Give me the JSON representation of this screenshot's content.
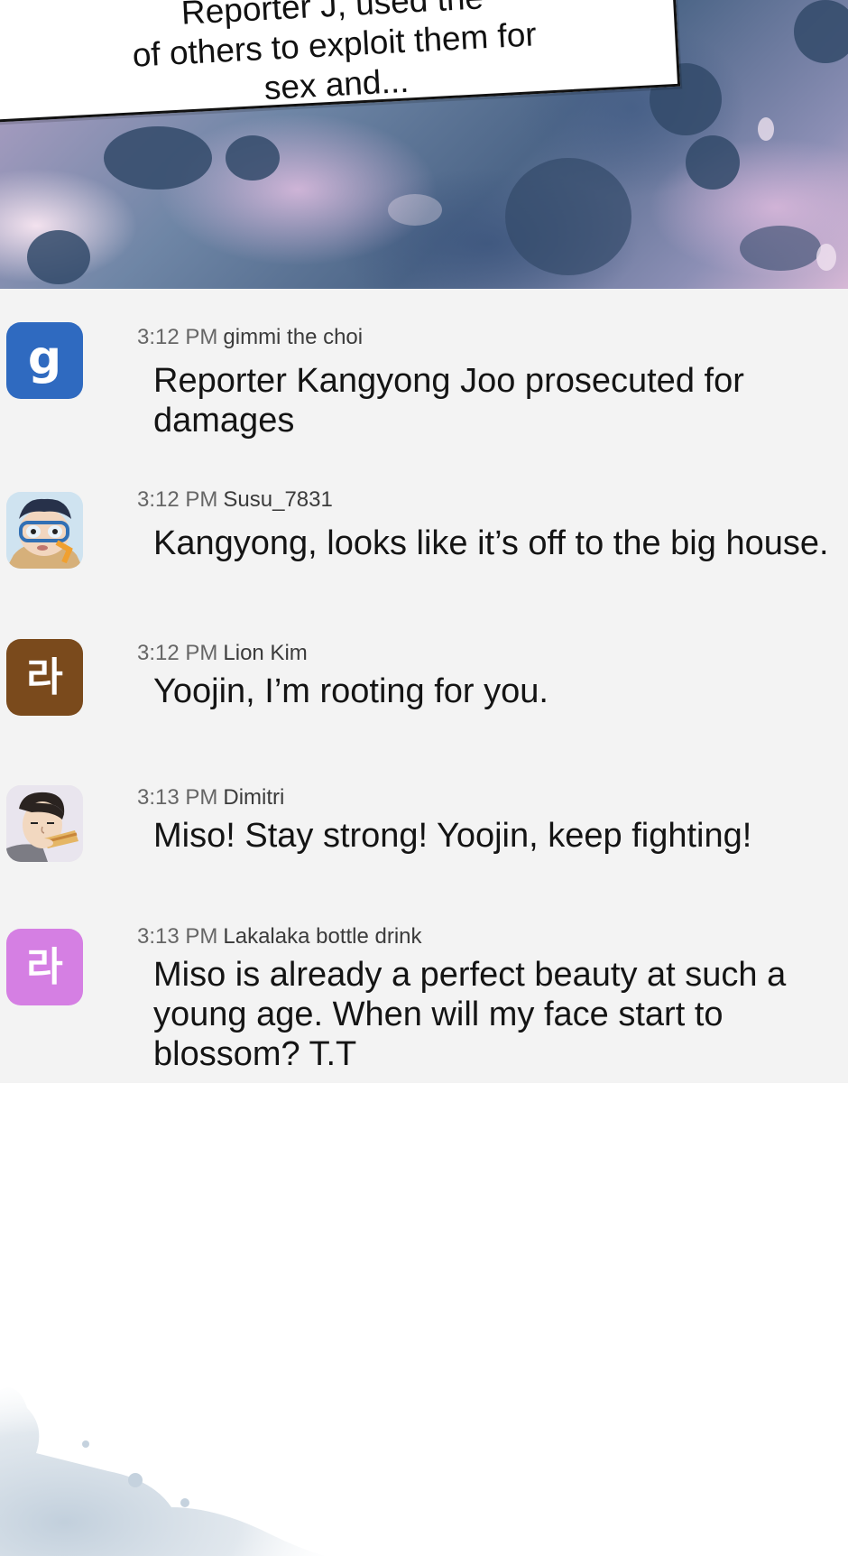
{
  "caption": {
    "text": "Reporter J, used the\nof others to exploit them for\nsex and..."
  },
  "comments": [
    {
      "time": "3:12 PM",
      "user": "gimmi the choi",
      "avatar": {
        "type": "letter",
        "glyph": "g",
        "color": "#2f6ac0"
      },
      "message": "Reporter Kangyong Joo prosecuted for damages"
    },
    {
      "time": "3:12 PM",
      "user": "Susu_7831",
      "avatar": {
        "type": "illustration",
        "icon": "diver-avatar-icon"
      },
      "message": "Kangyong, looks like it’s off to the big house."
    },
    {
      "time": "3:12 PM",
      "user": "Lion Kim",
      "avatar": {
        "type": "letter",
        "glyph": "라",
        "color": "#7a4a1c"
      },
      "message": "Yoojin, I’m rooting for you."
    },
    {
      "time": "3:13 PM",
      "user": "Dimitri",
      "avatar": {
        "type": "illustration",
        "icon": "man-eating-avatar-icon"
      },
      "message": "Miso! Stay strong! Yoojin, keep fighting!"
    },
    {
      "time": "3:13 PM",
      "user": "Lakalaka bottle drink",
      "avatar": {
        "type": "letter",
        "glyph": "라",
        "color": "#d57fe3"
      },
      "message": "Miso is already a perfect beauty at such a young age. When will my face start to blossom? T.T"
    }
  ],
  "colors": {
    "list_background": "#f3f3f3",
    "page_background": "#ffffff",
    "wash_blue": "#334a6a"
  }
}
